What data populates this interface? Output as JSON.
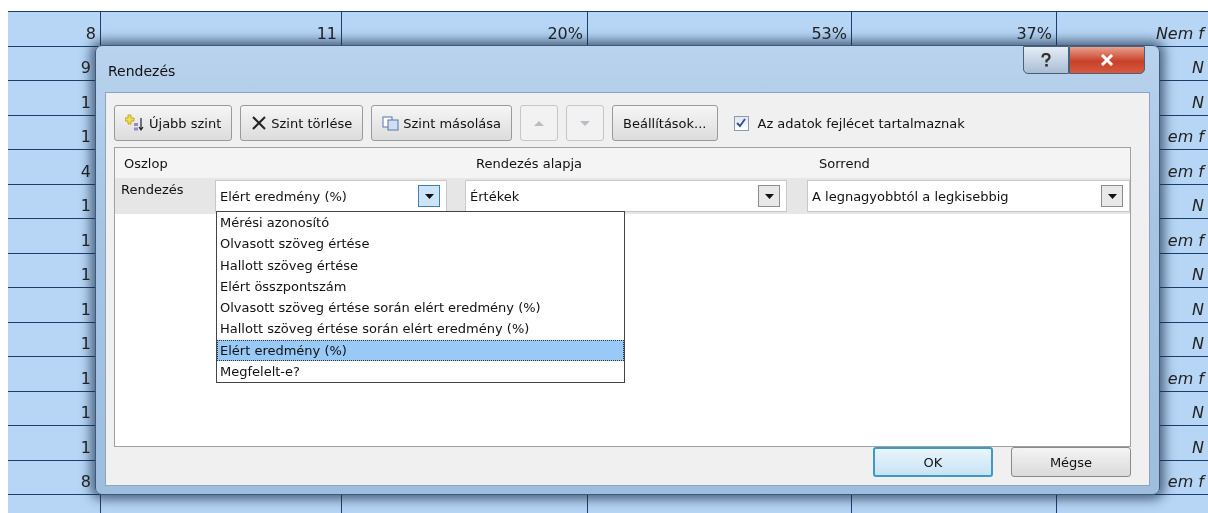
{
  "spreadsheet": {
    "rows": [
      {
        "kind": "full",
        "cells": [
          "8",
          "11",
          "20%",
          "53%",
          "37%",
          "Nem f"
        ]
      },
      {
        "kind": "covered",
        "first": "9",
        "last": "N"
      },
      {
        "kind": "covered",
        "first": "1",
        "last": "N"
      },
      {
        "kind": "covered",
        "first": "1",
        "last": "em f"
      },
      {
        "kind": "covered",
        "first": "4",
        "last": "em f"
      },
      {
        "kind": "covered",
        "first": "1",
        "last": "N"
      },
      {
        "kind": "covered",
        "first": "1",
        "last": "em f"
      },
      {
        "kind": "covered",
        "first": "1",
        "last": "N"
      },
      {
        "kind": "covered",
        "first": "1",
        "last": "N"
      },
      {
        "kind": "covered",
        "first": "1",
        "last": "N"
      },
      {
        "kind": "covered",
        "first": "1",
        "last": "em f"
      },
      {
        "kind": "covered",
        "first": "1",
        "last": "N"
      },
      {
        "kind": "covered",
        "first": "1",
        "last": "N"
      },
      {
        "kind": "covered",
        "first": "8",
        "last": "em f"
      }
    ]
  },
  "dialog": {
    "title": "Rendezés",
    "toolbar": [
      {
        "kind": "add",
        "label": "Újabb szint",
        "disabled": false
      },
      {
        "kind": "delete",
        "label": "Szint törlése",
        "disabled": false
      },
      {
        "kind": "copy",
        "label": "Szint másolása",
        "disabled": false
      },
      {
        "kind": "up",
        "disabled": true
      },
      {
        "kind": "down",
        "disabled": true
      },
      {
        "kind": "text",
        "label": "Beállítások...",
        "disabled": false
      }
    ],
    "header_checkbox": {
      "label": "Az adatok fejlécet tartalmaznak",
      "checked": true
    },
    "columns": [
      "Oszlop",
      "Rendezés alapja",
      "Sorrend"
    ],
    "levels": [
      {
        "label": "Rendezés",
        "column": {
          "value": "Elért eredmény (%)",
          "expanded": true
        },
        "basis": "Értékek",
        "order": "A legnagyobbtól a legkisebbig"
      }
    ],
    "column_options": [
      {
        "label": "Mérési azonosító",
        "selected": false
      },
      {
        "label": "Olvasott szöveg értése",
        "selected": false
      },
      {
        "label": "Hallott szöveg értése",
        "selected": false
      },
      {
        "label": "Elért összpontszám",
        "selected": false
      },
      {
        "label": "Olvasott szöveg értése során elért eredmény (%)",
        "selected": false
      },
      {
        "label": "Hallott szöveg értése során elért eredmény (%)",
        "selected": false
      },
      {
        "label": "Elért eredmény (%)",
        "selected": true
      },
      {
        "label": "Megfelelt-e?",
        "selected": false
      }
    ],
    "buttons": [
      {
        "label": "OK",
        "default": true
      },
      {
        "label": "Mégse",
        "default": false
      }
    ]
  }
}
